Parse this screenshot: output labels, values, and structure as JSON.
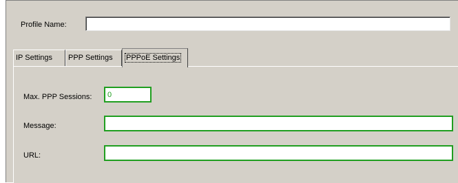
{
  "profile": {
    "label": "Profile Name:",
    "value": ""
  },
  "tabs": [
    {
      "label": "IP Settings",
      "active": false
    },
    {
      "label": "PPP Settings",
      "active": false
    },
    {
      "label": "PPPoE Settings",
      "active": true
    }
  ],
  "pppoe": {
    "max_sessions_label": "Max. PPP Sessions:",
    "max_sessions_value": "0",
    "message_label": "Message:",
    "message_value": "",
    "url_label": "URL:",
    "url_value": ""
  },
  "colors": {
    "dialog_bg": "#d4d0c8",
    "field_border_active": "#1f9e1f"
  }
}
